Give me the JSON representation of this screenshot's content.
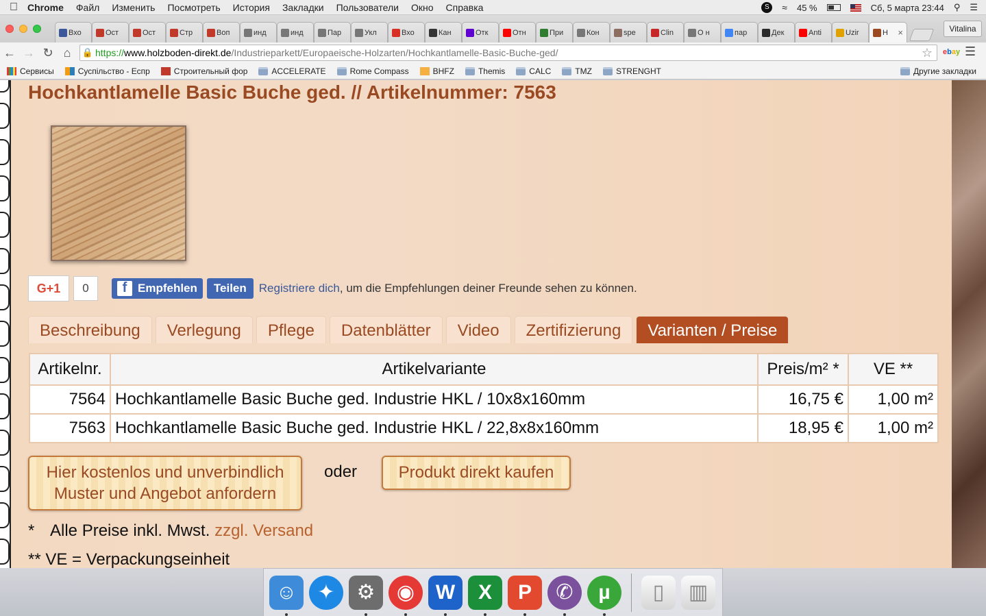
{
  "menubar": {
    "app": "Chrome",
    "items": [
      "Файл",
      "Изменить",
      "Посмотреть",
      "История",
      "Закладки",
      "Пользователи",
      "Окно",
      "Справка"
    ],
    "battery": "45 %",
    "datetime": "Сб, 5 марта  23:44"
  },
  "tabs": [
    {
      "label": "Вхо",
      "icon": "facebook-icon",
      "color": "#3b5998"
    },
    {
      "label": "Ост",
      "icon": "house-icon",
      "color": "#c0392b"
    },
    {
      "label": "Ост",
      "icon": "house-icon",
      "color": "#c0392b"
    },
    {
      "label": "Стр",
      "icon": "house-icon",
      "color": "#c0392b"
    },
    {
      "label": "Воп",
      "icon": "house-icon",
      "color": "#c0392b"
    },
    {
      "label": "инд",
      "icon": "page-icon",
      "color": "#777777"
    },
    {
      "label": "инд",
      "icon": "page-icon",
      "color": "#777777"
    },
    {
      "label": "Пар",
      "icon": "page-icon",
      "color": "#777777"
    },
    {
      "label": "Укл",
      "icon": "page-icon",
      "color": "#777777"
    },
    {
      "label": "Вхо",
      "icon": "gmail-icon",
      "color": "#d93025"
    },
    {
      "label": "Кан",
      "icon": "tv-icon",
      "color": "#333333"
    },
    {
      "label": "Отк",
      "icon": "yahoo-icon",
      "color": "#5f01d1"
    },
    {
      "label": "Отн",
      "icon": "youtube-icon",
      "color": "#ff0000"
    },
    {
      "label": "При",
      "icon": "green-page-icon",
      "color": "#2e7d32"
    },
    {
      "label": "Кон",
      "icon": "page-icon",
      "color": "#777777"
    },
    {
      "label": "spe",
      "icon": "pen-icon",
      "color": "#8d6e63"
    },
    {
      "label": "Clin",
      "icon": "shield-icon",
      "color": "#c62828"
    },
    {
      "label": "О н",
      "icon": "page-icon",
      "color": "#777777"
    },
    {
      "label": "пар",
      "icon": "google-icon",
      "color": "#4285f4"
    },
    {
      "label": "Дек",
      "icon": "leaf-icon",
      "color": "#2b2b2b"
    },
    {
      "label": "Anti",
      "icon": "youtube-icon",
      "color": "#ff0000"
    },
    {
      "label": "Uzir",
      "icon": "user-icon",
      "color": "#e0a200"
    },
    {
      "label": "H",
      "icon": "holzboden-icon",
      "color": "#9a4a22",
      "active": true
    }
  ],
  "profile": "Vitalina",
  "url": {
    "scheme": "https://",
    "domain": "www.holzboden-direkt.de",
    "path": "/Industrieparkett/Europaeische-Holzarten/Hochkantlamelle-Basic-Buche-ged/"
  },
  "extension_label": "ebay",
  "bookmarks": [
    {
      "label": "Сервисы",
      "type": "apps"
    },
    {
      "label": "Суспільство - Еспр",
      "type": "site"
    },
    {
      "label": "Строительный фор",
      "type": "site"
    },
    {
      "label": "ACCELERATE",
      "type": "folder"
    },
    {
      "label": "Rome Compass",
      "type": "folder"
    },
    {
      "label": "BHFZ",
      "type": "site"
    },
    {
      "label": "Themis",
      "type": "folder"
    },
    {
      "label": "CALC",
      "type": "folder"
    },
    {
      "label": "TMZ",
      "type": "folder"
    },
    {
      "label": "STRENGHT",
      "type": "folder"
    }
  ],
  "other_bookmarks": "Другие закладки",
  "page": {
    "title": "Hochkantlamelle Basic Buche ged. // Artikelnummer: 7563",
    "social": {
      "gplus": "G+1",
      "gplus_count": "0",
      "fb_recommend": "Empfehlen",
      "fb_share": "Teilen",
      "fb_link": "Registriere dich",
      "fb_text": ", um die Empfehlungen deiner Freunde sehen zu können."
    },
    "tabs": [
      "Beschreibung",
      "Verlegung",
      "Pflege",
      "Datenblätter",
      "Video",
      "Zertifizierung",
      "Varianten / Preise"
    ],
    "active_tab": "Varianten / Preise",
    "table": {
      "headers": [
        "Artikelnr.",
        "Artikelvariante",
        "Preis/m² *",
        "VE **"
      ],
      "rows": [
        [
          "7564",
          "Hochkantlamelle Basic Buche ged. Industrie HKL / 10x8x160mm",
          "16,75 €",
          "1,00 m²"
        ],
        [
          "7563",
          "Hochkantlamelle Basic Buche ged. Industrie HKL / 22,8x8x160mm",
          "18,95 €",
          "1,00 m²"
        ]
      ]
    },
    "cta_sample": "Hier kostenlos und unverbindlich Muster und Angebot anfordern",
    "or": "oder",
    "cta_buy": "Produkt direkt kaufen",
    "note1_star": "*",
    "note1_text": "Alle Preise inkl. Mwst.",
    "note1_link": "zzgl. Versand",
    "note2": "** VE = Verpackungseinheit"
  },
  "dock": [
    {
      "icon": "finder-icon",
      "color": "#3d8bd9"
    },
    {
      "icon": "safari-icon",
      "color": "#1e88e5"
    },
    {
      "icon": "system-preferences-icon",
      "color": "#6d6d6d"
    },
    {
      "icon": "chrome-icon",
      "color": "#e53935"
    },
    {
      "icon": "word-icon",
      "color": "#1e63c9"
    },
    {
      "icon": "excel-icon",
      "color": "#1b8f3a"
    },
    {
      "icon": "powerpoint-icon",
      "color": "#e2492f"
    },
    {
      "icon": "viber-icon",
      "color": "#7b519d"
    },
    {
      "icon": "utorrent-icon",
      "color": "#3aa73a"
    },
    {
      "icon": "document-icon",
      "color": "#dddddd"
    },
    {
      "icon": "trash-icon",
      "color": "#cccccc"
    }
  ]
}
